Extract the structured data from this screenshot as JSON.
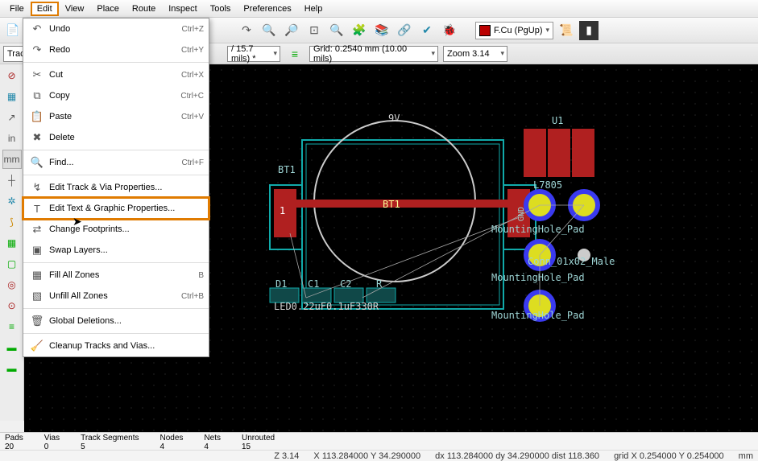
{
  "menubar": [
    "File",
    "Edit",
    "View",
    "Place",
    "Route",
    "Inspect",
    "Tools",
    "Preferences",
    "Help"
  ],
  "menubar_active": "Edit",
  "edit_menu": [
    {
      "icon": "↶",
      "label": "Undo",
      "shortcut": "Ctrl+Z"
    },
    {
      "icon": "↷",
      "label": "Redo",
      "shortcut": "Ctrl+Y"
    },
    {
      "sep": true
    },
    {
      "icon": "✂",
      "label": "Cut",
      "shortcut": "Ctrl+X"
    },
    {
      "icon": "⧉",
      "label": "Copy",
      "shortcut": "Ctrl+C"
    },
    {
      "icon": "📋",
      "label": "Paste",
      "shortcut": "Ctrl+V"
    },
    {
      "icon": "✖",
      "label": "Delete",
      "shortcut": ""
    },
    {
      "sep": true
    },
    {
      "icon": "🔍",
      "label": "Find...",
      "shortcut": "Ctrl+F"
    },
    {
      "sep": true
    },
    {
      "icon": "↯",
      "label": "Edit Track & Via Properties...",
      "shortcut": ""
    },
    {
      "icon": "T",
      "label": "Edit Text & Graphic Properties...",
      "shortcut": "",
      "hl": true
    },
    {
      "icon": "⇄",
      "label": "Change Footprints...",
      "shortcut": ""
    },
    {
      "icon": "▣",
      "label": "Swap Layers...",
      "shortcut": ""
    },
    {
      "sep": true
    },
    {
      "icon": "▦",
      "label": "Fill All Zones",
      "shortcut": "B"
    },
    {
      "icon": "▧",
      "label": "Unfill All Zones",
      "shortcut": "Ctrl+B"
    },
    {
      "sep": true
    },
    {
      "icon": "🗑",
      "label": "Global Deletions...",
      "shortcut": ""
    },
    {
      "sep": true
    },
    {
      "icon": "🧹",
      "label": "Cleanup Tracks and Vias...",
      "shortcut": ""
    }
  ],
  "layer_sel": "F.Cu (PgUp)",
  "track_sel": "/ 15.7 mils) *",
  "grid_sel": "Grid: 0.2540 mm (10.00 mils)",
  "zoom_sel": "Zoom 3.14",
  "left_tool_label": "Trac",
  "left_icons": [
    "◎",
    "▦",
    "↔",
    "in",
    "mm",
    "↕",
    "▣",
    "↯",
    "⊞",
    "⟲",
    "⊘",
    "≡",
    "▬",
    "▬"
  ],
  "canvas": {
    "labels": {
      "v9": "9V",
      "bt1a": "BT1",
      "bt1b": "BT1",
      "u1": "U1",
      "u1part": "L7805",
      "mh1": "MountingHole_Pad",
      "mh2": "MountingHole_Pad",
      "mh3": "MountingHole_Pad",
      "conn": "Conn_01x02_Male",
      "d1": "D1",
      "c1": "C1",
      "c2": "C2",
      "r": "R",
      "compline": "LED0.22uF0.1uF330R",
      "gnd": "GND",
      "pin1": "1"
    }
  },
  "status_top": [
    {
      "k": "Pads",
      "v": "20"
    },
    {
      "k": "Vias",
      "v": "0"
    },
    {
      "k": "Track Segments",
      "v": "5"
    },
    {
      "k": "Nodes",
      "v": "4"
    },
    {
      "k": "Nets",
      "v": "4"
    },
    {
      "k": "Unrouted",
      "v": "15"
    }
  ],
  "status_bot": {
    "zoom": "Z 3.14",
    "xy": "X 113.284000  Y 34.290000",
    "dxy": "dx 113.284000  dy 34.290000  dist 118.360",
    "grid": "grid X 0.254000  Y 0.254000",
    "unit": "mm"
  }
}
